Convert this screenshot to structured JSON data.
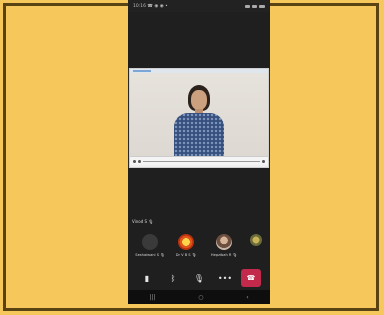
{
  "status": {
    "time": "10:16 ☎ ◉ ◉ •",
    "right": "◾◾ ◾◾ ◾◾"
  },
  "shared_screen": {
    "player_controls": "▶ ◀"
  },
  "self_label": "Vinod S 🎙",
  "participants": [
    {
      "name": "Seshaiwani S 🎙",
      "avatar": "initial-avatar"
    },
    {
      "name": "Dr V B S 🎙",
      "avatar": "sun-avatar"
    },
    {
      "name": "Hepzibah R 🎙",
      "avatar": "photo-avatar"
    },
    {
      "name": "",
      "avatar": "small-avatar"
    }
  ],
  "controls": [
    {
      "icon": "video-camera-icon",
      "glyph": "▮"
    },
    {
      "icon": "bluetooth-icon",
      "glyph": "ᛒ"
    },
    {
      "icon": "microphone-icon",
      "glyph": "🎙"
    },
    {
      "icon": "more-icon",
      "glyph": "•••"
    },
    {
      "icon": "end-call-icon",
      "glyph": "☎"
    }
  ],
  "navbar": [
    "|||",
    "○",
    "‹"
  ],
  "colors": {
    "background": "#f6c85b",
    "phone": "#1f1f1f",
    "end_call": "#c2294b"
  }
}
